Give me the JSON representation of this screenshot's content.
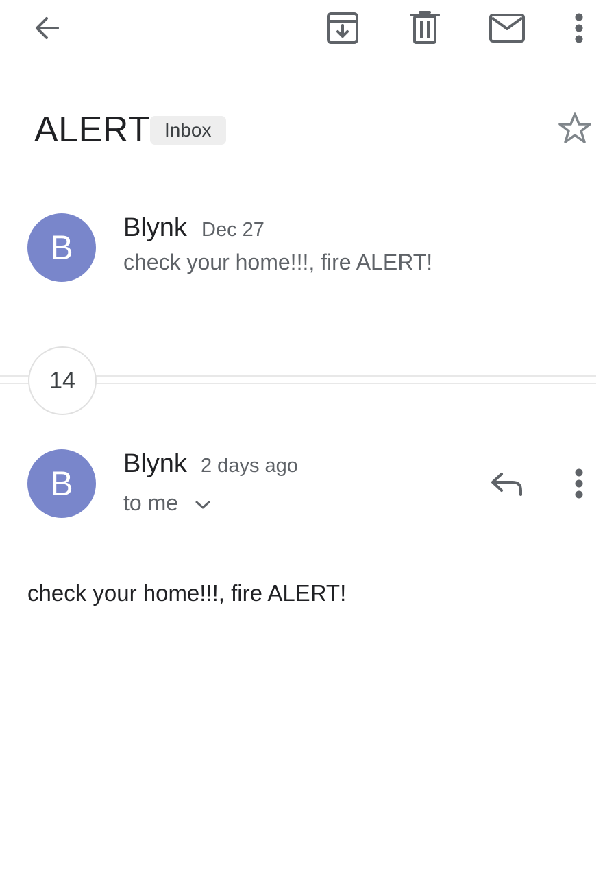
{
  "toolbar": {
    "back_icon": "arrow-back-icon",
    "archive_icon": "archive-icon",
    "delete_icon": "trash-icon",
    "mark_unread_icon": "envelope-icon",
    "more_icon": "more-vertical-icon"
  },
  "thread": {
    "subject": "ALERT",
    "label": "Inbox",
    "star_icon": "star-outline-icon"
  },
  "collapsed_message": {
    "avatar_letter": "B",
    "sender": "Blynk",
    "date": "Dec 27",
    "snippet": "check your home!!!, fire ALERT!"
  },
  "hidden_count": "14",
  "expanded_message": {
    "avatar_letter": "B",
    "sender": "Blynk",
    "date": "2 days ago",
    "recipient": "to me",
    "reply_icon": "reply-icon",
    "more_icon": "more-vertical-icon",
    "body": "check your home!!!, fire ALERT!"
  },
  "colors": {
    "avatar": "#7986cb",
    "icon": "#5f6368",
    "chip_bg": "#eeeeee"
  }
}
